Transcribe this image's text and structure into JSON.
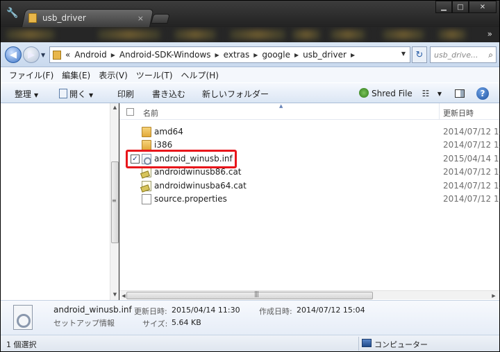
{
  "browser": {
    "tab_title": "usb_driver",
    "tab_close": "×",
    "more_bookmarks": "»",
    "window_buttons": {
      "minimize": "▁",
      "maximize": "□",
      "close": "✕"
    }
  },
  "address": {
    "overflow": "«",
    "crumbs": [
      "Android",
      "Android-SDK-Windows",
      "extras",
      "google",
      "usb_driver"
    ],
    "search_placeholder": "usb_drive..."
  },
  "menu": [
    "ファイル(F)",
    "編集(E)",
    "表示(V)",
    "ツール(T)",
    "ヘルプ(H)"
  ],
  "toolbar": {
    "organize": "整理",
    "open": "開く",
    "print": "印刷",
    "burn": "書き込む",
    "new_folder": "新しいフォルダー",
    "shred": "Shred File",
    "help": "?"
  },
  "columns": {
    "name": "名前",
    "date": "更新日時"
  },
  "files": [
    {
      "name": "amd64",
      "date": "2014/07/12 15",
      "type": "folder",
      "checked": false
    },
    {
      "name": "i386",
      "date": "2014/07/12 15",
      "type": "folder",
      "checked": false
    },
    {
      "name": "android_winusb.inf",
      "date": "2015/04/14 11",
      "type": "inf",
      "checked": true
    },
    {
      "name": "androidwinusb86.cat",
      "date": "2014/07/12 15",
      "type": "cat",
      "checked": false
    },
    {
      "name": "androidwinusba64.cat",
      "date": "2014/07/12 15",
      "type": "cat",
      "checked": false
    },
    {
      "name": "source.properties",
      "date": "2014/07/12 15",
      "type": "doc",
      "checked": false
    }
  ],
  "details": {
    "file_name": "android_winusb.inf",
    "file_type": "セットアップ情報",
    "modified_label": "更新日時:",
    "modified_value": "2015/04/14 11:30",
    "created_label": "作成日時:",
    "created_value": "2014/07/12 15:04",
    "size_label": "サイズ:",
    "size_value": "5.64 KB"
  },
  "status": {
    "selection": "1 個選択",
    "location": "コンピューター"
  },
  "colors": {
    "highlight": "#e8161b",
    "accent": "#2a5fa8"
  }
}
